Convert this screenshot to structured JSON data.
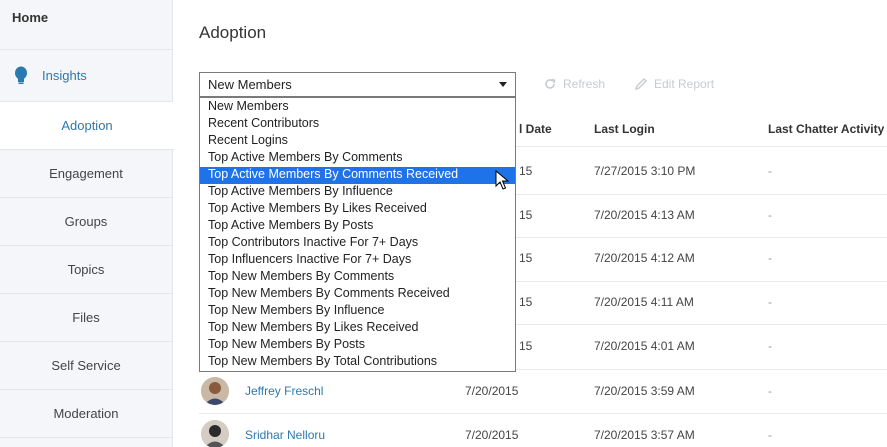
{
  "sidebar": {
    "home": "Home",
    "insights": "Insights",
    "items": [
      {
        "label": "Adoption"
      },
      {
        "label": "Engagement"
      },
      {
        "label": "Groups"
      },
      {
        "label": "Topics"
      },
      {
        "label": "Files"
      },
      {
        "label": "Self Service"
      },
      {
        "label": "Moderation"
      }
    ]
  },
  "main": {
    "title": "Adoption",
    "report_select": {
      "value": "New Members"
    },
    "toolbar": {
      "refresh": "Refresh",
      "edit_report": "Edit Report"
    },
    "columns": {
      "date_partial": "l Date",
      "last_login": "Last Login",
      "last_chatter": "Last Chatter Activity"
    },
    "rows": [
      {
        "date": "15",
        "last_login": "7/27/2015 3:10 PM",
        "chatter": "-"
      },
      {
        "date": "15",
        "last_login": "7/20/2015 4:13 AM",
        "chatter": "-"
      },
      {
        "date": "15",
        "last_login": "7/20/2015 4:12 AM",
        "chatter": "-"
      },
      {
        "date": "15",
        "last_login": "7/20/2015 4:11 AM",
        "chatter": "-"
      },
      {
        "date": "15",
        "last_login": "7/20/2015 4:01 AM",
        "chatter": "-"
      },
      {
        "name": "Jeffrey Freschl",
        "date": "7/20/2015",
        "last_login": "7/20/2015 3:59 AM",
        "chatter": "-"
      },
      {
        "name": "Sridhar Nelloru",
        "date": "7/20/2015",
        "last_login": "7/20/2015 3:57 AM",
        "chatter": "-"
      }
    ]
  },
  "dropdown": {
    "options": [
      "New Members",
      "Recent Contributors",
      "Recent Logins",
      "Top Active Members By Comments",
      "Top Active Members By Comments Received",
      "Top Active Members By Influence",
      "Top Active Members By Likes Received",
      "Top Active Members By Posts",
      "Top Contributors Inactive For 7+ Days",
      "Top Influencers Inactive For 7+ Days",
      "Top New Members By Comments",
      "Top New Members By Comments Received",
      "Top New Members By Influence",
      "Top New Members By Likes Received",
      "Top New Members By Posts",
      "Top New Members By Total Contributions"
    ],
    "highlighted": "Top Active Members By Comments Received"
  },
  "colors": {
    "accent": "#2a7ab0",
    "highlight": "#1e73e8",
    "sidebar_bg": "#f4f6f9"
  }
}
